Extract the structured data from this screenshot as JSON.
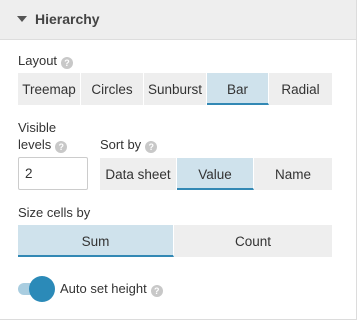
{
  "section": {
    "title": "Hierarchy",
    "collapse_icon": "caret-down-icon"
  },
  "layout": {
    "label": "Layout",
    "options": [
      "Treemap",
      "Circles",
      "Sunburst",
      "Bar",
      "Radial"
    ],
    "selected": "Bar"
  },
  "visible_levels": {
    "label_line1": "Visible",
    "label_line2": "levels",
    "value": "2"
  },
  "sort_by": {
    "label": "Sort by",
    "options": [
      "Data sheet",
      "Value",
      "Name"
    ],
    "selected": "Value"
  },
  "size_cells_by": {
    "label": "Size cells by",
    "options": [
      "Sum",
      "Count"
    ],
    "selected": "Sum"
  },
  "auto_set_height": {
    "label": "Auto set height",
    "enabled": true
  },
  "colors": {
    "accent": "#2b8ab8",
    "active_bg": "#cfe2ec",
    "segment_bg": "#eeeeee"
  },
  "help_glyph": "?"
}
